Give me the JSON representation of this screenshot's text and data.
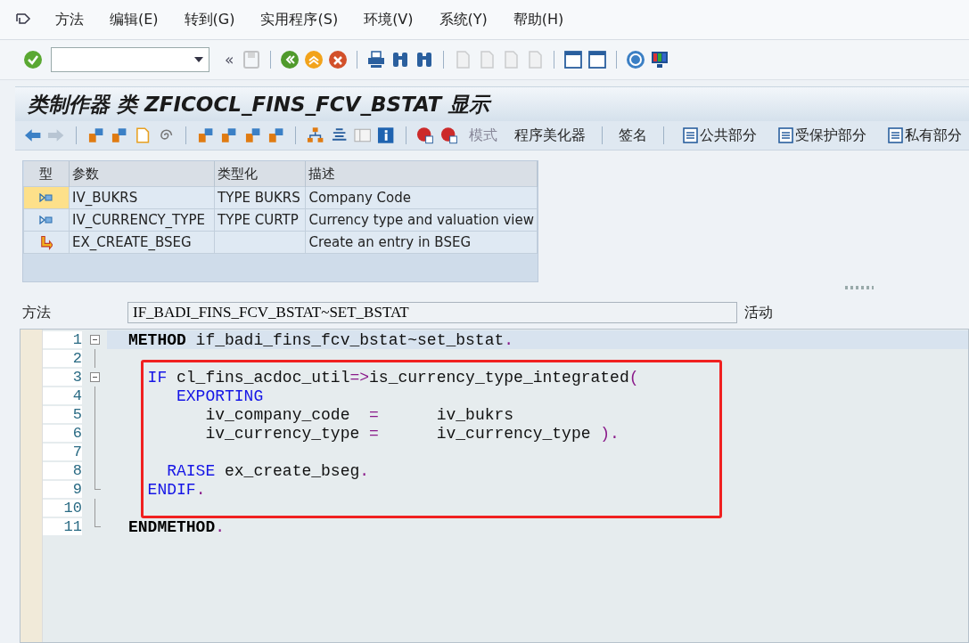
{
  "menu_bar": [
    {
      "label": "方法"
    },
    {
      "label": "编辑(E)"
    },
    {
      "label": "转到(G)"
    },
    {
      "label": "实用程序(S)"
    },
    {
      "label": "环境(V)"
    },
    {
      "label": "系统(Y)"
    },
    {
      "label": "帮助(H)"
    }
  ],
  "standard_toolbar": [
    {
      "kind": "icon",
      "disabled": false
    },
    {
      "kind": "field"
    },
    {
      "kind": "chevron",
      "label": "«"
    },
    {
      "kind": "icon",
      "disabled": true
    },
    {
      "kind": "sep"
    },
    {
      "kind": "icon",
      "disabled": false
    },
    {
      "kind": "icon",
      "disabled": false
    },
    {
      "kind": "icon",
      "disabled": false
    },
    {
      "kind": "sep"
    },
    {
      "kind": "icon",
      "disabled": false
    },
    {
      "kind": "icon",
      "disabled": false
    },
    {
      "kind": "icon",
      "disabled": false
    },
    {
      "kind": "sep"
    },
    {
      "kind": "icon",
      "disabled": true
    },
    {
      "kind": "icon",
      "disabled": true
    },
    {
      "kind": "icon",
      "disabled": true
    },
    {
      "kind": "icon",
      "disabled": true
    },
    {
      "kind": "sep"
    },
    {
      "kind": "icon",
      "disabled": false
    },
    {
      "kind": "icon",
      "disabled": false
    },
    {
      "kind": "sep"
    },
    {
      "kind": "icon",
      "disabled": false
    },
    {
      "kind": "icon",
      "disabled": false
    }
  ],
  "window": {
    "title": "类制作器 类 ZFICOCL_FINS_FCV_BSTAT 显示"
  },
  "app_toolbar": [
    {
      "kind": "icon",
      "disabled": false
    },
    {
      "kind": "icon",
      "disabled": true
    },
    {
      "kind": "sep"
    },
    {
      "kind": "icon",
      "disabled": false
    },
    {
      "kind": "icon",
      "disabled": false
    },
    {
      "kind": "icon",
      "disabled": false
    },
    {
      "kind": "icon",
      "disabled": false
    },
    {
      "kind": "sep"
    },
    {
      "kind": "icon",
      "disabled": false
    },
    {
      "kind": "icon",
      "disabled": false
    },
    {
      "kind": "icon",
      "disabled": false
    },
    {
      "kind": "icon",
      "disabled": false
    },
    {
      "kind": "sep"
    },
    {
      "kind": "icon",
      "disabled": false
    },
    {
      "kind": "icon",
      "disabled": false
    },
    {
      "kind": "icon",
      "disabled": false
    },
    {
      "kind": "icon",
      "disabled": false
    },
    {
      "kind": "sep"
    },
    {
      "kind": "icon",
      "disabled": false
    },
    {
      "kind": "icon",
      "disabled": false
    },
    {
      "kind": "text",
      "label": "模式",
      "disabled": true
    },
    {
      "kind": "text",
      "label": "程序美化器",
      "disabled": false
    },
    {
      "kind": "sep"
    },
    {
      "kind": "text",
      "label": "签名",
      "disabled": false
    },
    {
      "kind": "sep"
    },
    {
      "kind": "icontext",
      "label": "公共部分",
      "disabled": false
    },
    {
      "kind": "icontext",
      "label": "受保护部分",
      "disabled": false
    },
    {
      "kind": "icontext",
      "label": "私有部分",
      "disabled": false
    }
  ],
  "table": {
    "columns": [
      "型",
      "参数",
      "类型化",
      "描述"
    ],
    "rows": [
      {
        "kind": "importing",
        "selected": true,
        "parameter": "IV_BUKRS",
        "typing": "TYPE BUKRS",
        "description": "Company Code"
      },
      {
        "kind": "importing",
        "selected": false,
        "parameter": "IV_CURRENCY_TYPE",
        "typing": "TYPE CURTP",
        "description": "Currency type and valuation view"
      },
      {
        "kind": "exception",
        "selected": false,
        "parameter": "EX_CREATE_BSEG",
        "description": "Create an entry in BSEG"
      }
    ]
  },
  "method": {
    "label": "方法",
    "value": "IF_BADI_FINS_FCV_BSTAT~SET_BSTAT",
    "status": "活动"
  },
  "editor": {
    "lines": [
      {
        "kind": "line",
        "number": "1",
        "collapsible": true,
        "block_end": false,
        "current": true,
        "tokens": [
          {
            "kind": "bold",
            "text": "METHOD"
          },
          {
            "kind": "plain",
            "text": " if_badi_fins_fcv_bstat~set_bstat"
          },
          {
            "kind": "op",
            "text": "."
          }
        ]
      },
      {
        "kind": "line",
        "number": "2",
        "collapsible": false,
        "block_end": false,
        "current": false
      },
      {
        "kind": "highlight",
        "lines": [
          {
            "number": "3",
            "collapsible": true,
            "block_end": false,
            "current": false,
            "tokens": [
              {
                "kind": "kw",
                "text": "  IF"
              },
              {
                "kind": "plain",
                "text": " cl_fins_acdoc_util"
              },
              {
                "kind": "op",
                "text": "=>"
              },
              {
                "kind": "plain",
                "text": "is_currency_type_integrated"
              },
              {
                "kind": "op",
                "text": "("
              }
            ]
          },
          {
            "number": "4",
            "collapsible": false,
            "block_end": false,
            "current": false,
            "tokens": [
              {
                "kind": "kw",
                "text": "     EXPORTING"
              }
            ]
          },
          {
            "number": "5",
            "collapsible": false,
            "block_end": false,
            "current": false,
            "tokens": [
              {
                "kind": "plain",
                "text": "        iv_company_code  "
              },
              {
                "kind": "op",
                "text": "="
              },
              {
                "kind": "plain",
                "text": "      iv_bukrs"
              }
            ]
          },
          {
            "number": "6",
            "collapsible": false,
            "block_end": false,
            "current": false,
            "tokens": [
              {
                "kind": "plain",
                "text": "        iv_currency_type "
              },
              {
                "kind": "op",
                "text": "="
              },
              {
                "kind": "plain",
                "text": "      iv_currency_type "
              },
              {
                "kind": "op",
                "text": ")."
              }
            ]
          },
          {
            "number": "7",
            "collapsible": false,
            "block_end": false,
            "current": false
          },
          {
            "number": "8",
            "collapsible": false,
            "block_end": false,
            "current": false,
            "tokens": [
              {
                "kind": "kw",
                "text": "    RAISE"
              },
              {
                "kind": "plain",
                "text": " ex_create_bseg"
              },
              {
                "kind": "op",
                "text": "."
              }
            ]
          },
          {
            "number": "9",
            "collapsible": false,
            "block_end": true,
            "current": false,
            "tokens": [
              {
                "kind": "kw",
                "text": "  ENDIF"
              },
              {
                "kind": "op",
                "text": "."
              }
            ]
          },
          {
            "number": "10",
            "collapsible": false,
            "block_end": false,
            "current": false
          }
        ]
      },
      {
        "kind": "line",
        "number": "11",
        "collapsible": false,
        "block_end": true,
        "current": false,
        "tokens": [
          {
            "kind": "bold",
            "text": "ENDMETHOD"
          },
          {
            "kind": "op",
            "text": "."
          }
        ]
      }
    ]
  }
}
